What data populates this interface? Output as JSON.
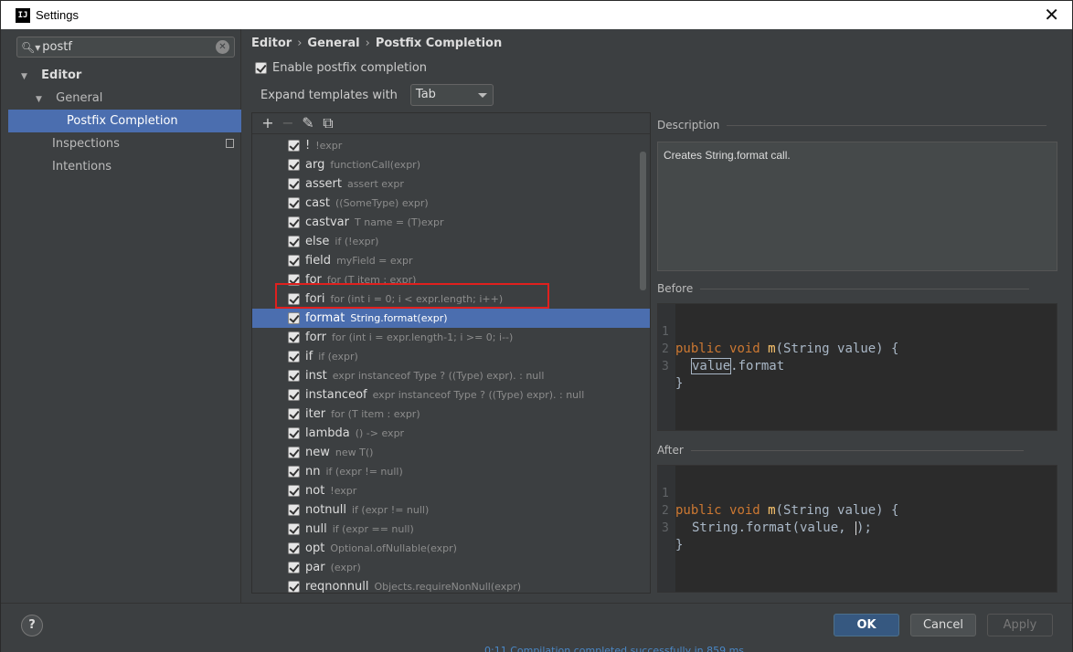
{
  "window": {
    "title": "Settings",
    "app_icon": "IJ"
  },
  "sidebar": {
    "search_value": "postf",
    "items": [
      {
        "label": "Editor"
      },
      {
        "label": "General"
      },
      {
        "label": "Postfix Completion"
      },
      {
        "label": "Inspections"
      },
      {
        "label": "Intentions"
      }
    ]
  },
  "breadcrumb": {
    "a": "Editor",
    "b": "General",
    "c": "Postfix Completion"
  },
  "settings": {
    "enable_label": "Enable postfix completion",
    "expand_label": "Expand templates with",
    "expand_value": "Tab"
  },
  "toolbar": {
    "add": "+",
    "remove": "−",
    "edit": "✎",
    "copy": "⧉"
  },
  "templates": [
    {
      "key": "!",
      "example": "!expr"
    },
    {
      "key": "arg",
      "example": "functionCall(expr)"
    },
    {
      "key": "assert",
      "example": "assert expr"
    },
    {
      "key": "cast",
      "example": "((SomeType) expr)"
    },
    {
      "key": "castvar",
      "example": "T name = (T)expr"
    },
    {
      "key": "else",
      "example": "if (!expr)"
    },
    {
      "key": "field",
      "example": "myField = expr"
    },
    {
      "key": "for",
      "example": "for (T item : expr)"
    },
    {
      "key": "fori",
      "example": "for (int i = 0; i < expr.length; i++)"
    },
    {
      "key": "format",
      "example": "String.format(expr)"
    },
    {
      "key": "forr",
      "example": "for (int i = expr.length-1; i >= 0; i--)"
    },
    {
      "key": "if",
      "example": "if (expr)"
    },
    {
      "key": "inst",
      "example": "expr instanceof Type ? ((Type) expr). : null"
    },
    {
      "key": "instanceof",
      "example": "expr instanceof Type ? ((Type) expr). : null"
    },
    {
      "key": "iter",
      "example": "for (T item : expr)"
    },
    {
      "key": "lambda",
      "example": "() -> expr"
    },
    {
      "key": "new",
      "example": "new T()"
    },
    {
      "key": "nn",
      "example": "if (expr != null)"
    },
    {
      "key": "not",
      "example": "!expr"
    },
    {
      "key": "notnull",
      "example": "if (expr != null)"
    },
    {
      "key": "null",
      "example": "if (expr == null)"
    },
    {
      "key": "opt",
      "example": "Optional.ofNullable(expr)"
    },
    {
      "key": "par",
      "example": "(expr)"
    },
    {
      "key": "reqnonnull",
      "example": "Objects.requireNonNull(expr)"
    }
  ],
  "selected_template": "format",
  "description": {
    "title": "Description",
    "text": "Creates String.format call."
  },
  "before": {
    "title": "Before",
    "line_numbers": [
      "1",
      "2",
      "3"
    ],
    "kw1": "public",
    "kw2": "void",
    "fn": "m",
    "sig": "(String value) {",
    "line2_a": "value",
    "line2_b": ".format",
    "line3": "}"
  },
  "after": {
    "title": "After",
    "line_numbers": [
      "1",
      "2",
      "3"
    ],
    "kw1": "public",
    "kw2": "void",
    "fn": "m",
    "sig": "(String value) {",
    "line2_a": "String.format(value, ",
    "line2_b": ");",
    "line3": "}"
  },
  "footer": {
    "help": "?",
    "ok": "OK",
    "cancel": "Cancel",
    "apply": "Apply"
  },
  "background_status": "0:11  Compilation completed successfully in 859 ms"
}
